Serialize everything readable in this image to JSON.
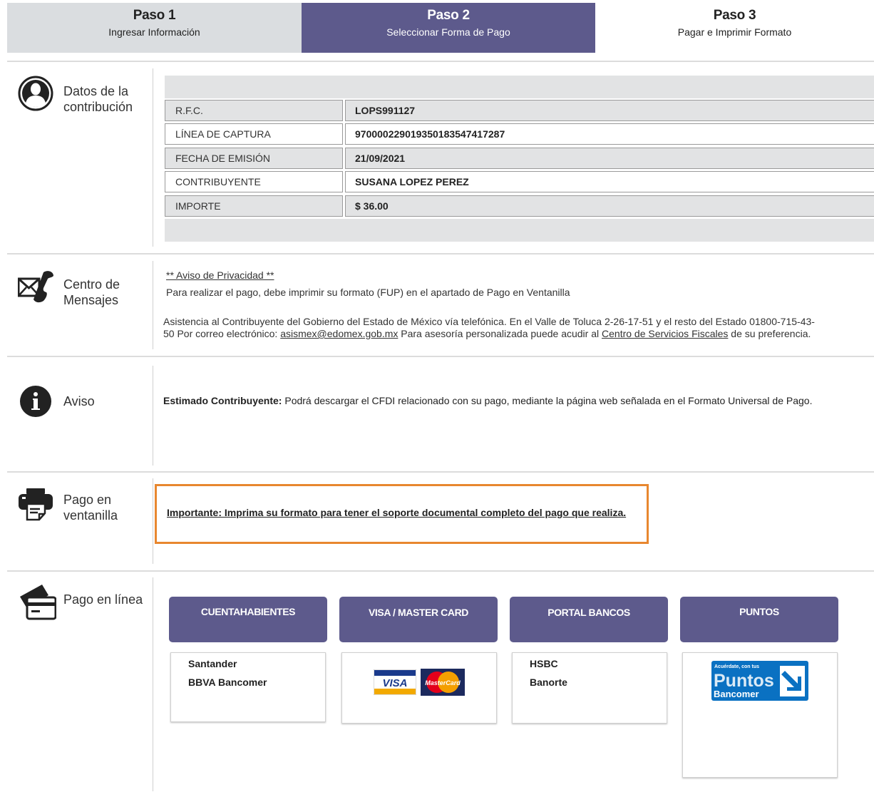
{
  "steps": [
    {
      "title": "Paso 1",
      "subtitle": "Ingresar Información"
    },
    {
      "title": "Paso 2",
      "subtitle": "Seleccionar Forma de Pago"
    },
    {
      "title": "Paso 3",
      "subtitle": "Pagar e Imprimir Formato"
    }
  ],
  "contribution": {
    "label": "Datos de la contribución",
    "icon": "user-circle-icon",
    "rows": [
      {
        "key": "R.F.C.",
        "value": "LOPS991127"
      },
      {
        "key": "LÍNEA DE CAPTURA",
        "value": "970000229019350183547417287"
      },
      {
        "key": "FECHA DE EMISIÓN",
        "value": "21/09/2021"
      },
      {
        "key": "CONTRIBUYENTE",
        "value": "SUSANA LOPEZ PEREZ"
      },
      {
        "key": "IMPORTE",
        "value": "$ 36.00"
      }
    ]
  },
  "messages": {
    "label": "Centro de Mensajes",
    "icon": "envelope-phone-icon",
    "privacy_link": "** Aviso de Privacidad **",
    "line1": "Para realizar el pago, debe imprimir su formato (FUP) en el apartado de Pago en Ventanilla",
    "assist_a": "Asistencia al Contribuyente del Gobierno del Estado de México vía telefónica. En el Valle de Toluca 2-26-17-51 y el resto del Estado 01800-715-43-",
    "assist_b": "50 Por correo electrónico: ",
    "email": "asismex@edomex.gob.mx",
    "assist_c": " Para asesoría personalizada puede acudir al ",
    "centers_link": "Centro de Servicios Fiscales",
    "assist_d": " de su preferencia."
  },
  "notice": {
    "label": "Aviso",
    "icon": "info-circle-icon",
    "bold": "Estimado Contribuyente:",
    "text": " Podrá descargar el CFDI relacionado con su pago, mediante la página web señalada en el Formato Universal de Pago."
  },
  "counter": {
    "label": "Pago en ventanilla",
    "icon": "printer-icon",
    "important": "Importante: Imprima su formato para tener el soporte documental completo del pago que realiza."
  },
  "online": {
    "label": "Pago en línea",
    "icon": "credit-card-icon",
    "options": [
      {
        "tab": "CUENTAHABIENTES",
        "banks": [
          "Santander",
          "BBVA Bancomer"
        ]
      },
      {
        "tab": "VISA / MASTER CARD",
        "logos": [
          "VISA",
          "MasterCard"
        ]
      },
      {
        "tab": "PORTAL BANCOS",
        "banks": [
          "HSBC",
          "Banorte"
        ]
      },
      {
        "tab": "PUNTOS",
        "logo_lines": [
          "Acuérdate, con tus",
          "Puntos",
          "Bancomer"
        ]
      }
    ]
  },
  "colors": {
    "primary": "#5d5a8c",
    "highlight_border": "#e8872f",
    "step_inactive": "#dadde0"
  }
}
